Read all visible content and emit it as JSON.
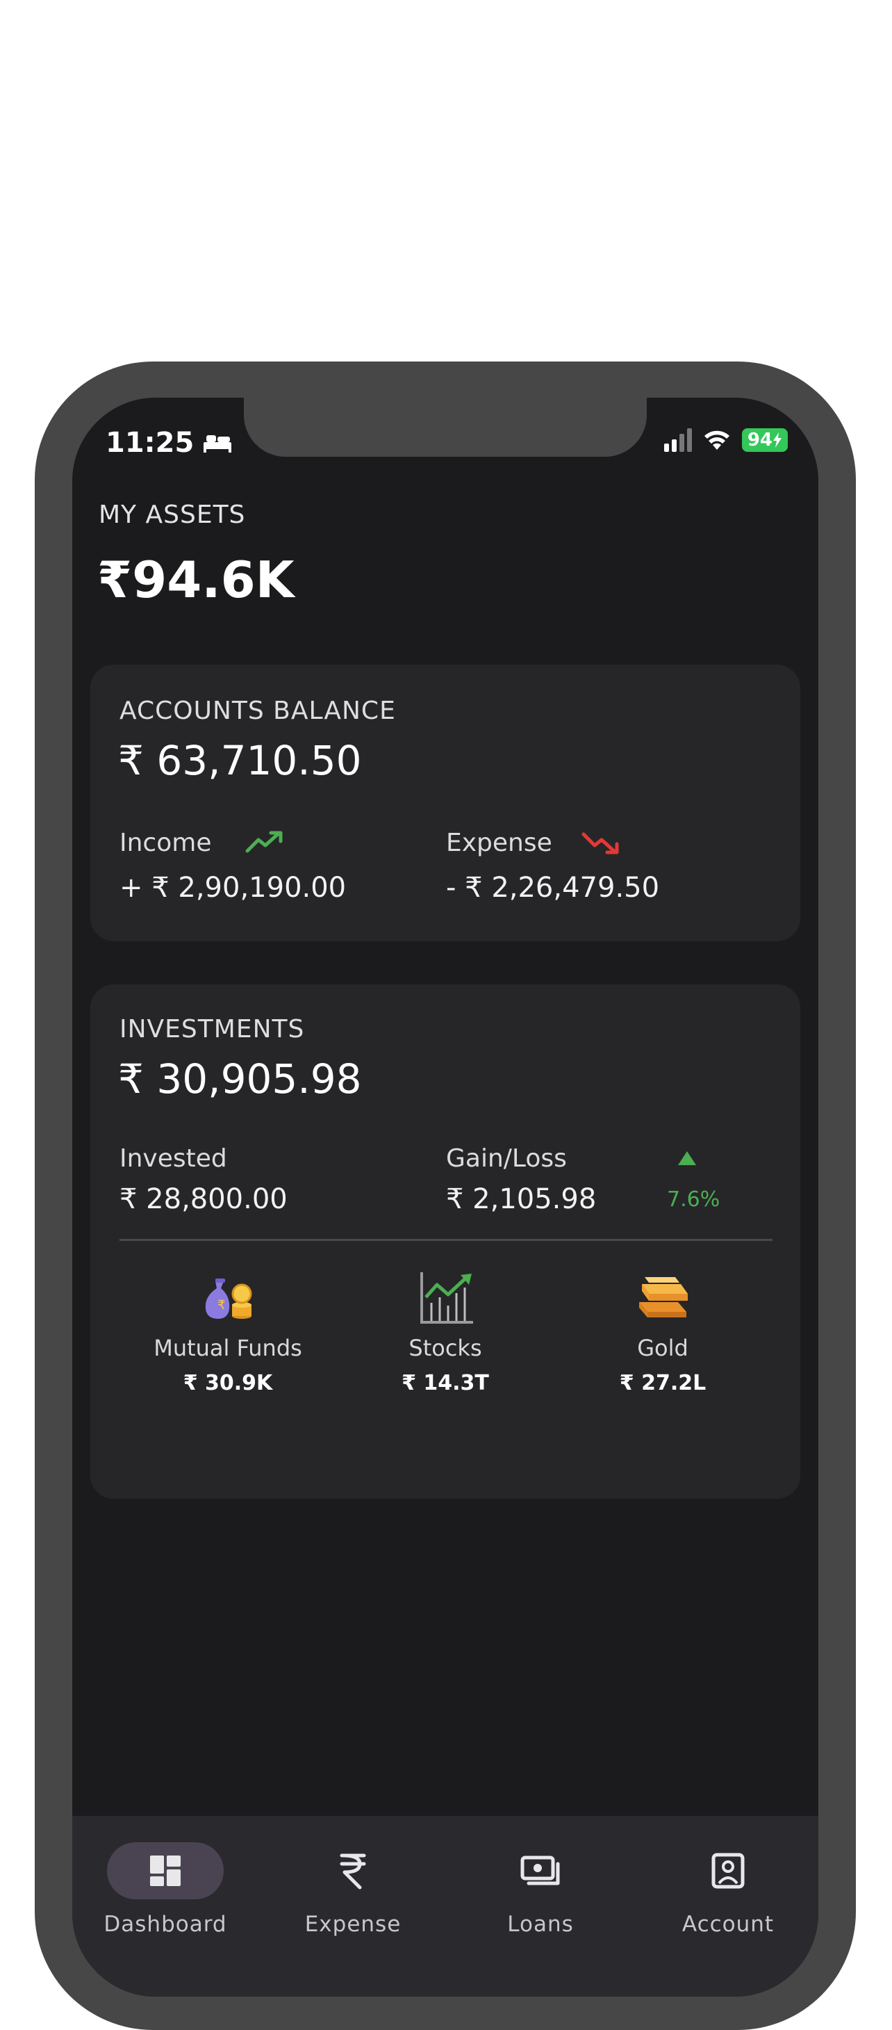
{
  "status_bar": {
    "time": "11:25",
    "battery": "94"
  },
  "assets": {
    "label": "MY ASSETS",
    "value": "₹94.6K"
  },
  "accounts": {
    "title": "ACCOUNTS BALANCE",
    "balance": "₹ 63,710.50",
    "income_label": "Income",
    "income_value": "+ ₹ 2,90,190.00",
    "expense_label": "Expense",
    "expense_value": "- ₹ 2,26,479.50"
  },
  "investments": {
    "title": "INVESTMENTS",
    "value": "₹ 30,905.98",
    "invested_label": "Invested",
    "invested_value": "₹ 28,800.00",
    "gain_label": "Gain/Loss",
    "gain_value": "₹ 2,105.98",
    "gain_percent": "7.6%",
    "items": [
      {
        "name": "Mutual Funds",
        "value": "₹ 30.9K",
        "icon": "money-bag-icon"
      },
      {
        "name": "Stocks",
        "value": "₹ 14.3T",
        "icon": "stock-chart-icon"
      },
      {
        "name": "Gold",
        "value": "₹ 27.2L",
        "icon": "gold-bars-icon"
      }
    ]
  },
  "tabs": [
    {
      "label": "Dashboard",
      "icon": "dashboard-icon",
      "active": true
    },
    {
      "label": "Expense",
      "icon": "rupee-icon",
      "active": false
    },
    {
      "label": "Loans",
      "icon": "cash-icon",
      "active": false
    },
    {
      "label": "Account",
      "icon": "account-icon",
      "active": false
    }
  ],
  "colors": {
    "positive": "#4caf50",
    "negative": "#e53935",
    "card": "#262629",
    "background": "#1b1b1d"
  }
}
